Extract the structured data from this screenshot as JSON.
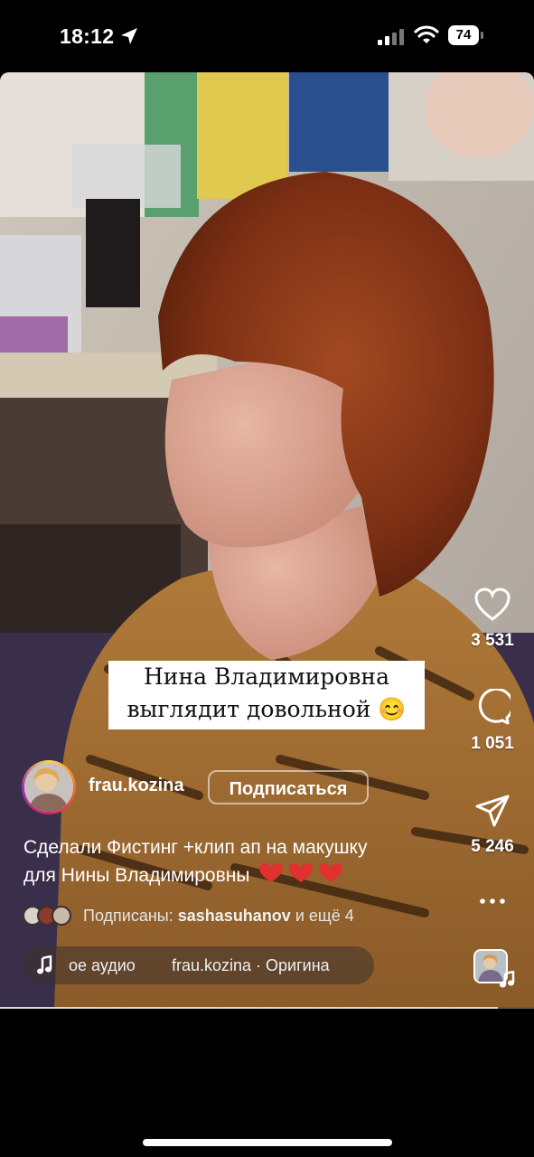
{
  "status_bar": {
    "time": "18:12",
    "battery": "74"
  },
  "sticker": {
    "line1": "Нина Владимировна",
    "line2": "выглядит довольной 😊"
  },
  "actions": {
    "likes": "3 531",
    "comments": "1 051",
    "shares": "5 246"
  },
  "author": {
    "username": "frau.kozina",
    "follow_label": "Подписаться"
  },
  "caption": {
    "line1": "Сделали Фистинг +клип ап на макушку",
    "line2": "для Нины Владимировны"
  },
  "followed_by": {
    "label": "Подписаны:",
    "users": "sashasuhanov",
    "more": "и ещё 4"
  },
  "audio": {
    "title_fragment": "ое аудио",
    "source": "frau.kozina · Оригина"
  },
  "colors": {
    "heart_emoji": "#e0312f",
    "avatar_ring": "#d3265e"
  },
  "icons": [
    "location-arrow-icon",
    "cellular-signal-icon",
    "wifi-icon",
    "battery-icon",
    "heart-icon",
    "comment-icon",
    "share-icon",
    "more-icon",
    "music-note-icon"
  ]
}
